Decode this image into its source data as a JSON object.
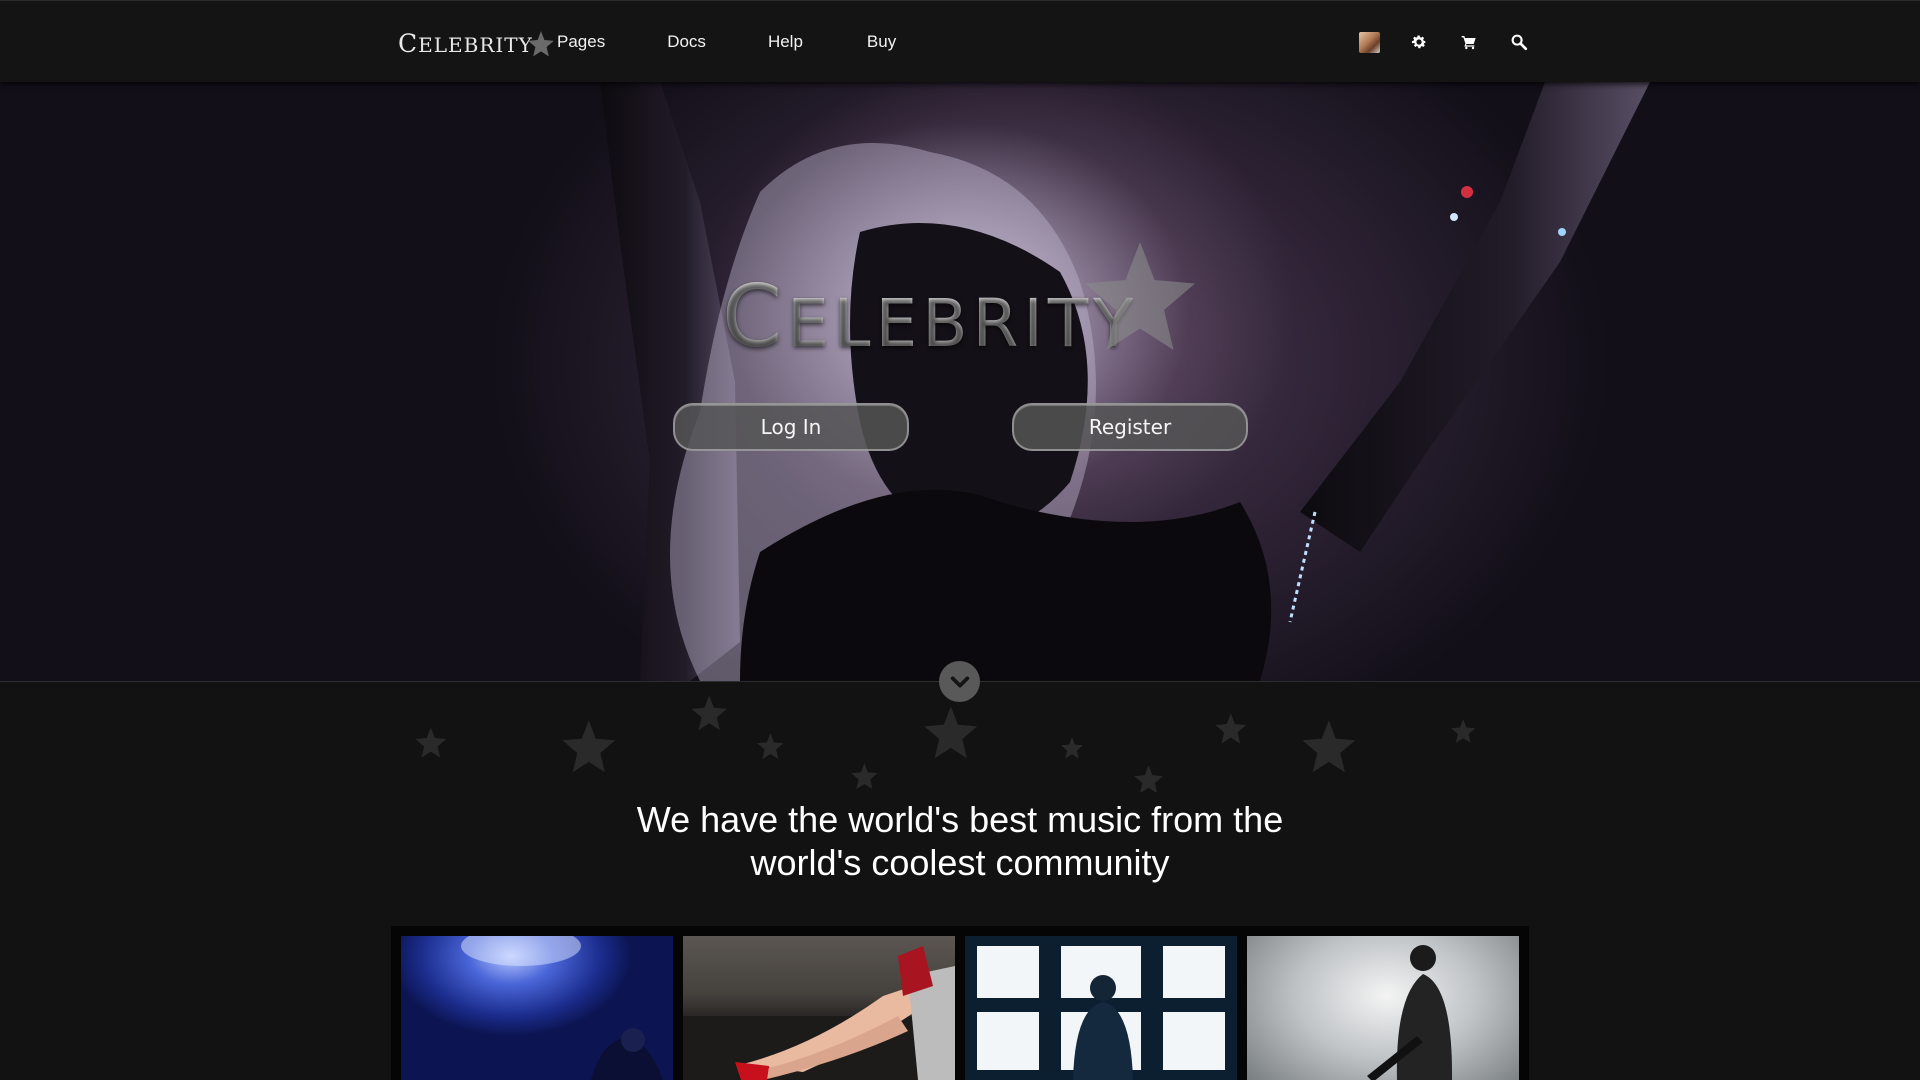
{
  "brand": {
    "first_letter": "C",
    "rest": "ELEBRITY"
  },
  "nav": {
    "items": [
      "Pages",
      "Docs",
      "Help",
      "Buy"
    ]
  },
  "header_icons": [
    "avatar",
    "gear-icon",
    "cart-icon",
    "search-icon"
  ],
  "hero": {
    "title_first_letter": "C",
    "title_rest": "ELEBRITY",
    "login_label": "Log In",
    "register_label": "Register"
  },
  "tagline": {
    "line1": "We have the world's best music from the",
    "line2": "world's coolest community"
  },
  "gallery": {
    "items": [
      "concert-stage-photo",
      "red-heels-couch-photo",
      "man-at-window-photo",
      "soldier-silhouette-photo"
    ]
  },
  "colors": {
    "background": "#121212",
    "topbar": "#141414",
    "button_fill": "#555555",
    "scroll_button": "#595959",
    "star_decor": "#2a2a2a"
  }
}
